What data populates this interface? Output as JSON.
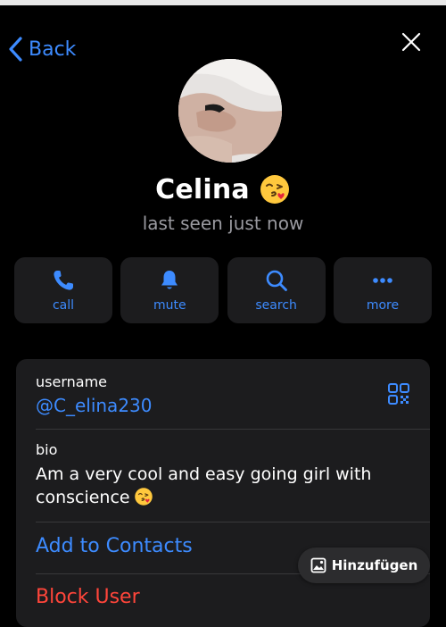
{
  "nav": {
    "back_label": "Back"
  },
  "profile": {
    "name": "Celina",
    "status": "last seen just now"
  },
  "actions": [
    {
      "label": "call",
      "icon": "phone-icon"
    },
    {
      "label": "mute",
      "icon": "bell-icon"
    },
    {
      "label": "search",
      "icon": "search-icon"
    },
    {
      "label": "more",
      "icon": "ellipsis-icon"
    }
  ],
  "info": {
    "username_label": "username",
    "username": "@C_elina230",
    "bio_label": "bio",
    "bio": "Am a very cool and easy going girl with conscience",
    "add_contacts": "Add to Contacts",
    "block_user": "Block User"
  },
  "overlay": {
    "translate_label": "Hinzufügen"
  },
  "colors": {
    "accent": "#3d8bff",
    "background": "#000000",
    "card": "#1c1c1e",
    "danger": "#ff453a",
    "muted": "#9a9aa0"
  }
}
